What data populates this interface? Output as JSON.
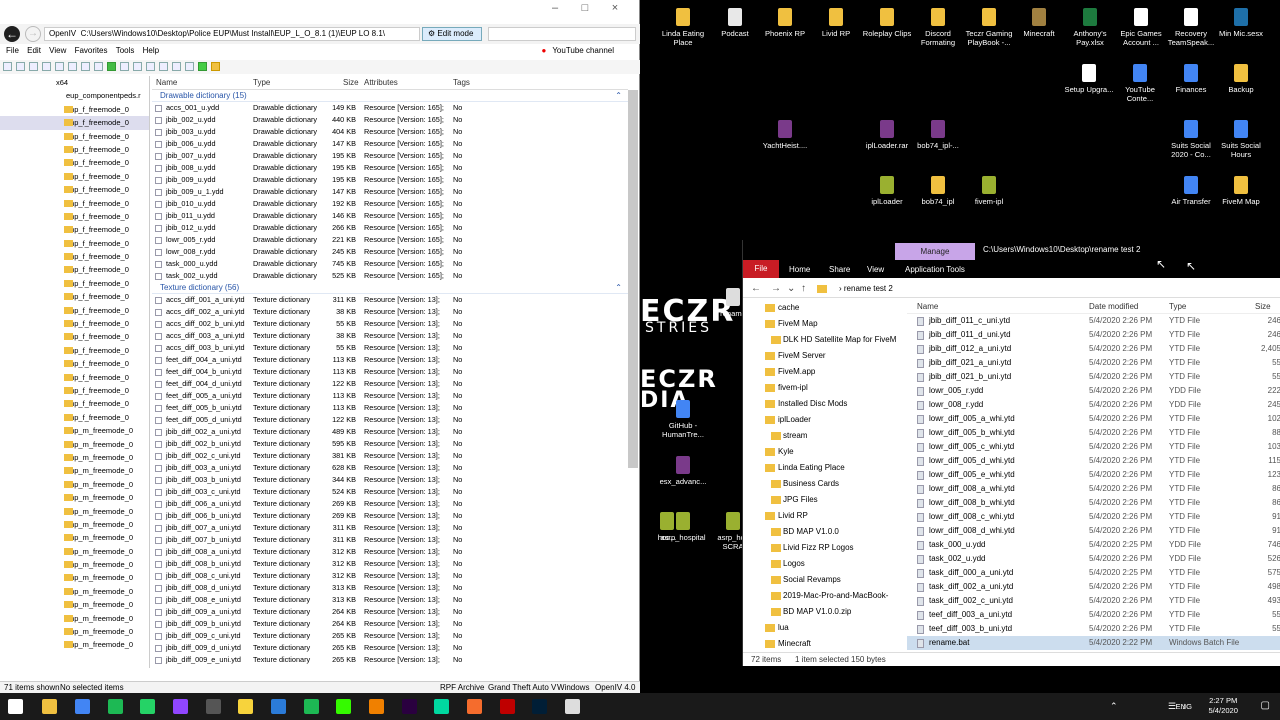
{
  "openiv": {
    "title": "OpenIV",
    "path": "C:\\Users\\Windows10\\Desktop\\Police EUP\\Must Install\\EUP_L_O_8.1 (1)\\EUP LO 8.1\\",
    "edit_mode": "Edit mode",
    "menu": [
      "File",
      "Edit",
      "View",
      "Favorites",
      "Tools",
      "Help"
    ],
    "youtube": "YouTube channel",
    "tree_header_1": "x64",
    "tree_header_2": "eup_componentpeds.r",
    "tree_items": [
      "mp_f_freemode_0",
      "mp_f_freemode_0",
      "mp_f_freemode_0",
      "mp_f_freemode_0",
      "mp_f_freemode_0",
      "mp_f_freemode_0",
      "mp_f_freemode_0",
      "mp_f_freemode_0",
      "mp_f_freemode_0",
      "mp_f_freemode_0",
      "mp_f_freemode_0",
      "mp_f_freemode_0",
      "mp_f_freemode_0",
      "mp_f_freemode_0",
      "mp_f_freemode_0",
      "mp_f_freemode_0",
      "mp_f_freemode_0",
      "mp_f_freemode_0",
      "mp_f_freemode_0",
      "mp_f_freemode_0",
      "mp_f_freemode_0",
      "mp_f_freemode_0",
      "mp_f_freemode_0",
      "mp_f_freemode_0",
      "mp_m_freemode_0",
      "mp_m_freemode_0",
      "mp_m_freemode_0",
      "mp_m_freemode_0",
      "mp_m_freemode_0",
      "mp_m_freemode_0",
      "mp_m_freemode_0",
      "mp_m_freemode_0",
      "mp_m_freemode_0",
      "mp_m_freemode_0",
      "mp_m_freemode_0",
      "mp_m_freemode_0",
      "mp_m_freemode_0",
      "mp_m_freemode_0",
      "mp_m_freemode_0",
      "mp_m_freemode_0",
      "mp_m_freemode_0"
    ],
    "columns": [
      "Name",
      "Type",
      "Size",
      "Attributes",
      "Tags"
    ],
    "group1": "Drawable dictionary (15)",
    "group2": "Texture dictionary (56)",
    "drawables": [
      [
        "accs_001_u.ydd",
        "Drawable dictionary",
        "149 KB",
        "Resource [Version: 165];",
        "No"
      ],
      [
        "jbib_002_u.ydd",
        "Drawable dictionary",
        "440 KB",
        "Resource [Version: 165];",
        "No"
      ],
      [
        "jbib_003_u.ydd",
        "Drawable dictionary",
        "404 KB",
        "Resource [Version: 165];",
        "No"
      ],
      [
        "jbib_006_u.ydd",
        "Drawable dictionary",
        "147 KB",
        "Resource [Version: 165];",
        "No"
      ],
      [
        "jbib_007_u.ydd",
        "Drawable dictionary",
        "195 KB",
        "Resource [Version: 165];",
        "No"
      ],
      [
        "jbib_008_u.ydd",
        "Drawable dictionary",
        "195 KB",
        "Resource [Version: 165];",
        "No"
      ],
      [
        "jbib_009_u.ydd",
        "Drawable dictionary",
        "195 KB",
        "Resource [Version: 165];",
        "No"
      ],
      [
        "jbib_009_u_1.ydd",
        "Drawable dictionary",
        "147 KB",
        "Resource [Version: 165];",
        "No"
      ],
      [
        "jbib_010_u.ydd",
        "Drawable dictionary",
        "192 KB",
        "Resource [Version: 165];",
        "No"
      ],
      [
        "jbib_011_u.ydd",
        "Drawable dictionary",
        "146 KB",
        "Resource [Version: 165];",
        "No"
      ],
      [
        "jbib_012_u.ydd",
        "Drawable dictionary",
        "266 KB",
        "Resource [Version: 165];",
        "No"
      ],
      [
        "lowr_005_r.ydd",
        "Drawable dictionary",
        "221 KB",
        "Resource [Version: 165];",
        "No"
      ],
      [
        "lowr_008_r.ydd",
        "Drawable dictionary",
        "245 KB",
        "Resource [Version: 165];",
        "No"
      ],
      [
        "task_000_u.ydd",
        "Drawable dictionary",
        "745 KB",
        "Resource [Version: 165];",
        "No"
      ],
      [
        "task_002_u.ydd",
        "Drawable dictionary",
        "525 KB",
        "Resource [Version: 165];",
        "No"
      ]
    ],
    "textures": [
      [
        "accs_diff_001_a_uni.ytd",
        "Texture dictionary",
        "311 KB",
        "Resource [Version: 13];",
        "No"
      ],
      [
        "accs_diff_002_a_uni.ytd",
        "Texture dictionary",
        "38 KB",
        "Resource [Version: 13];",
        "No"
      ],
      [
        "accs_diff_002_b_uni.ytd",
        "Texture dictionary",
        "55 KB",
        "Resource [Version: 13];",
        "No"
      ],
      [
        "accs_diff_003_a_uni.ytd",
        "Texture dictionary",
        "38 KB",
        "Resource [Version: 13];",
        "No"
      ],
      [
        "accs_diff_003_b_uni.ytd",
        "Texture dictionary",
        "55 KB",
        "Resource [Version: 13];",
        "No"
      ],
      [
        "feet_diff_004_a_uni.ytd",
        "Texture dictionary",
        "113 KB",
        "Resource [Version: 13];",
        "No"
      ],
      [
        "feet_diff_004_b_uni.ytd",
        "Texture dictionary",
        "113 KB",
        "Resource [Version: 13];",
        "No"
      ],
      [
        "feet_diff_004_d_uni.ytd",
        "Texture dictionary",
        "122 KB",
        "Resource [Version: 13];",
        "No"
      ],
      [
        "feet_diff_005_a_uni.ytd",
        "Texture dictionary",
        "113 KB",
        "Resource [Version: 13];",
        "No"
      ],
      [
        "feet_diff_005_b_uni.ytd",
        "Texture dictionary",
        "113 KB",
        "Resource [Version: 13];",
        "No"
      ],
      [
        "feet_diff_005_d_uni.ytd",
        "Texture dictionary",
        "122 KB",
        "Resource [Version: 13];",
        "No"
      ],
      [
        "jbib_diff_002_a_uni.ytd",
        "Texture dictionary",
        "489 KB",
        "Resource [Version: 13];",
        "No"
      ],
      [
        "jbib_diff_002_b_uni.ytd",
        "Texture dictionary",
        "595 KB",
        "Resource [Version: 13];",
        "No"
      ],
      [
        "jbib_diff_002_c_uni.ytd",
        "Texture dictionary",
        "381 KB",
        "Resource [Version: 13];",
        "No"
      ],
      [
        "jbib_diff_003_a_uni.ytd",
        "Texture dictionary",
        "628 KB",
        "Resource [Version: 13];",
        "No"
      ],
      [
        "jbib_diff_003_b_uni.ytd",
        "Texture dictionary",
        "344 KB",
        "Resource [Version: 13];",
        "No"
      ],
      [
        "jbib_diff_003_c_uni.ytd",
        "Texture dictionary",
        "524 KB",
        "Resource [Version: 13];",
        "No"
      ],
      [
        "jbib_diff_006_a_uni.ytd",
        "Texture dictionary",
        "269 KB",
        "Resource [Version: 13];",
        "No"
      ],
      [
        "jbib_diff_006_b_uni.ytd",
        "Texture dictionary",
        "269 KB",
        "Resource [Version: 13];",
        "No"
      ],
      [
        "jbib_diff_007_a_uni.ytd",
        "Texture dictionary",
        "311 KB",
        "Resource [Version: 13];",
        "No"
      ],
      [
        "jbib_diff_007_b_uni.ytd",
        "Texture dictionary",
        "311 KB",
        "Resource [Version: 13];",
        "No"
      ],
      [
        "jbib_diff_008_a_uni.ytd",
        "Texture dictionary",
        "312 KB",
        "Resource [Version: 13];",
        "No"
      ],
      [
        "jbib_diff_008_b_uni.ytd",
        "Texture dictionary",
        "312 KB",
        "Resource [Version: 13];",
        "No"
      ],
      [
        "jbib_diff_008_c_uni.ytd",
        "Texture dictionary",
        "312 KB",
        "Resource [Version: 13];",
        "No"
      ],
      [
        "jbib_diff_008_d_uni.ytd",
        "Texture dictionary",
        "313 KB",
        "Resource [Version: 13];",
        "No"
      ],
      [
        "jbib_diff_008_e_uni.ytd",
        "Texture dictionary",
        "313 KB",
        "Resource [Version: 13];",
        "No"
      ],
      [
        "jbib_diff_009_a_uni.ytd",
        "Texture dictionary",
        "264 KB",
        "Resource [Version: 13];",
        "No"
      ],
      [
        "jbib_diff_009_b_uni.ytd",
        "Texture dictionary",
        "264 KB",
        "Resource [Version: 13];",
        "No"
      ],
      [
        "jbib_diff_009_c_uni.ytd",
        "Texture dictionary",
        "265 KB",
        "Resource [Version: 13];",
        "No"
      ],
      [
        "jbib_diff_009_d_uni.ytd",
        "Texture dictionary",
        "265 KB",
        "Resource [Version: 13];",
        "No"
      ],
      [
        "jbib_diff_009_e_uni.ytd",
        "Texture dictionary",
        "265 KB",
        "Resource [Version: 13];",
        "No"
      ]
    ],
    "status": {
      "shown": "71 items shown",
      "selected": "No selected items",
      "archive": "RPF Archive",
      "game": "Grand Theft Auto V",
      "os": "Windows",
      "version": "OpenIV 4.0"
    }
  },
  "desktop": {
    "icons": [
      {
        "label": "Linda Eating Place",
        "color": "#f0c040"
      },
      {
        "label": "Podcast",
        "color": "#e8e8e8"
      },
      {
        "label": "Phoenix RP",
        "color": "#f0c040"
      },
      {
        "label": "Livid RP",
        "color": "#f0c040"
      },
      {
        "label": "Roleplay Clips",
        "color": "#f0c040"
      },
      {
        "label": "Discord Formating",
        "color": "#f0c040"
      },
      {
        "label": "Teczr Gaming PlayBook -...",
        "color": "#f0c040"
      },
      {
        "label": "Minecraft",
        "color": "#a08040"
      },
      {
        "label": "Anthony's Pay.xlsx",
        "color": "#1d7a3e"
      },
      {
        "label": "Epic Games Account ...",
        "color": "#ffffff"
      },
      {
        "label": "Recovery TeamSpeak...",
        "color": "#ffffff"
      },
      {
        "label": "Min Mic.sesx",
        "color": "#1e6fa8"
      },
      {
        "label": "Setup Upgra...",
        "color": "#ffffff"
      },
      {
        "label": "YouTube Conte...",
        "color": "#4285f4"
      },
      {
        "label": "Finances",
        "color": "#4285f4"
      },
      {
        "label": "Backup",
        "color": "#f0c040"
      },
      {
        "label": "YachtHeist....",
        "color": "#7a3a8a"
      },
      {
        "label": "iplLoader.rar",
        "color": "#7a3a8a"
      },
      {
        "label": "bob74_ipl-...",
        "color": "#7a3a8a"
      },
      {
        "label": "Suits Social 2020 - Co...",
        "color": "#4285f4"
      },
      {
        "label": "Suits Social Hours",
        "color": "#4285f4"
      },
      {
        "label": "iplLoader",
        "color": "#9ab030"
      },
      {
        "label": "bob74_ipl",
        "color": "#f0c040"
      },
      {
        "label": "fivem-ipl",
        "color": "#9ab030"
      },
      {
        "label": "Air Transfer",
        "color": "#4285f4"
      },
      {
        "label": "FiveM Map",
        "color": "#f0c040"
      },
      {
        "label": "GitHub - HumanTre...",
        "color": "#4285f4"
      },
      {
        "label": "esx_advanc...",
        "color": "#7a3a8a"
      },
      {
        "label": "asrp_hospital",
        "color": "#9ab030"
      },
      {
        "label": "asrp_hos SCRA",
        "color": "#9ab030"
      },
      {
        "label": "rename",
        "color": "#dddddd"
      },
      {
        "label": "hos...",
        "color": "#9ab030"
      }
    ],
    "wallpaper_text_1": "ECZR",
    "wallpaper_text_2": "STRIES",
    "wallpaper_text_3": "ECZR",
    "wallpaper_text_4": "DIA"
  },
  "explorer": {
    "manage": "Manage",
    "title_path": "C:\\Users\\Windows10\\Desktop\\rename test 2",
    "ribbon": [
      "File",
      "Home",
      "Share",
      "View",
      "Application Tools"
    ],
    "crumb": "rename test 2",
    "tree": [
      {
        "label": "cache",
        "sub": false
      },
      {
        "label": "FiveM Map",
        "sub": false
      },
      {
        "label": "DLK HD Satellite Map for FiveM",
        "sub": true
      },
      {
        "label": "FiveM Server",
        "sub": false
      },
      {
        "label": "FiveM.app",
        "sub": false
      },
      {
        "label": "fivem-ipl",
        "sub": false
      },
      {
        "label": "Installed Disc Mods",
        "sub": false
      },
      {
        "label": "iplLoader",
        "sub": false
      },
      {
        "label": "stream",
        "sub": true
      },
      {
        "label": "Kyle",
        "sub": false
      },
      {
        "label": "Linda Eating Place",
        "sub": false
      },
      {
        "label": "Business Cards",
        "sub": true
      },
      {
        "label": "JPG Files",
        "sub": true
      },
      {
        "label": "Livid RP",
        "sub": false
      },
      {
        "label": "BD MAP V1.0.0",
        "sub": true
      },
      {
        "label": "Livid Fizz RP Logos",
        "sub": true
      },
      {
        "label": "Logos",
        "sub": true
      },
      {
        "label": "Social Revamps",
        "sub": true
      },
      {
        "label": "2019-Mac-Pro-and-MacBook-",
        "sub": true
      },
      {
        "label": "BD MAP V1.0.0.zip",
        "sub": true
      },
      {
        "label": "lua",
        "sub": false
      },
      {
        "label": "Minecraft",
        "sub": false
      }
    ],
    "columns": [
      "Name",
      "Date modified",
      "Type",
      "Size"
    ],
    "files": [
      [
        "jbib_diff_011_c_uni.ytd",
        "5/4/2020 2:26 PM",
        "YTD File",
        "246"
      ],
      [
        "jbib_diff_011_d_uni.ytd",
        "5/4/2020 2:26 PM",
        "YTD File",
        "246"
      ],
      [
        "jbib_diff_012_a_uni.ytd",
        "5/4/2020 2:26 PM",
        "YTD File",
        "2,405"
      ],
      [
        "jbib_diff_021_a_uni.ytd",
        "5/4/2020 2:26 PM",
        "YTD File",
        "55"
      ],
      [
        "jbib_diff_021_b_uni.ytd",
        "5/4/2020 2:26 PM",
        "YTD File",
        "55"
      ],
      [
        "lowr_005_r.ydd",
        "5/4/2020 2:26 PM",
        "YDD File",
        "222"
      ],
      [
        "lowr_008_r.ydd",
        "5/4/2020 2:26 PM",
        "YDD File",
        "245"
      ],
      [
        "lowr_diff_005_a_whi.ytd",
        "5/4/2020 2:26 PM",
        "YTD File",
        "102"
      ],
      [
        "lowr_diff_005_b_whi.ytd",
        "5/4/2020 2:26 PM",
        "YTD File",
        "88"
      ],
      [
        "lowr_diff_005_c_whi.ytd",
        "5/4/2020 2:26 PM",
        "YTD File",
        "103"
      ],
      [
        "lowr_diff_005_d_whi.ytd",
        "5/4/2020 2:26 PM",
        "YTD File",
        "115"
      ],
      [
        "lowr_diff_005_e_whi.ytd",
        "5/4/2020 2:26 PM",
        "YTD File",
        "123"
      ],
      [
        "lowr_diff_008_a_whi.ytd",
        "5/4/2020 2:26 PM",
        "YTD File",
        "86"
      ],
      [
        "lowr_diff_008_b_whi.ytd",
        "5/4/2020 2:26 PM",
        "YTD File",
        "86"
      ],
      [
        "lowr_diff_008_c_whi.ytd",
        "5/4/2020 2:26 PM",
        "YTD File",
        "91"
      ],
      [
        "lowr_diff_008_d_whi.ytd",
        "5/4/2020 2:26 PM",
        "YTD File",
        "91"
      ],
      [
        "task_000_u.ydd",
        "5/4/2020 2:25 PM",
        "YDD File",
        "746"
      ],
      [
        "task_002_u.ydd",
        "5/4/2020 2:26 PM",
        "YDD File",
        "526"
      ],
      [
        "task_diff_000_a_uni.ytd",
        "5/4/2020 2:25 PM",
        "YTD File",
        "575"
      ],
      [
        "task_diff_002_a_uni.ytd",
        "5/4/2020 2:26 PM",
        "YTD File",
        "498"
      ],
      [
        "task_diff_002_c_uni.ytd",
        "5/4/2020 2:26 PM",
        "YTD File",
        "493"
      ],
      [
        "teef_diff_003_a_uni.ytd",
        "5/4/2020 2:26 PM",
        "YTD File",
        "55"
      ],
      [
        "teef_diff_003_b_uni.ytd",
        "5/4/2020 2:26 PM",
        "YTD File",
        "55"
      ],
      [
        "rename.bat",
        "5/4/2020 2:22 PM",
        "Windows Batch File",
        ""
      ]
    ],
    "status": {
      "count": "72 items",
      "selected": "1 item selected  150 bytes"
    }
  },
  "taskbar": {
    "apps": [
      {
        "name": "start-icon",
        "color": "#ffffff"
      },
      {
        "name": "file-explorer-icon",
        "color": "#f0c040"
      },
      {
        "name": "chrome-icon",
        "color": "#4285f4"
      },
      {
        "name": "spotify-icon",
        "color": "#1db954"
      },
      {
        "name": "whatsapp-icon",
        "color": "#25d366"
      },
      {
        "name": "twitch-icon",
        "color": "#9146ff"
      },
      {
        "name": "obs-icon",
        "color": "#555555"
      },
      {
        "name": "sticky-notes-icon",
        "color": "#f7d33c"
      },
      {
        "name": "paint-icon",
        "color": "#2b7bd8"
      },
      {
        "name": "spotify-alt-icon",
        "color": "#1db954"
      },
      {
        "name": "dreamweaver-icon",
        "color": "#35fa00"
      },
      {
        "name": "vlc-icon",
        "color": "#f08000"
      },
      {
        "name": "premiere-icon",
        "color": "#2a003f"
      },
      {
        "name": "audition-icon",
        "color": "#00d8a0"
      },
      {
        "name": "origin-icon",
        "color": "#f56c2d"
      },
      {
        "name": "filezilla-icon",
        "color": "#bf0000"
      },
      {
        "name": "photoshop-icon",
        "color": "#001e36"
      },
      {
        "name": "openiv-icon",
        "color": "#dddddd"
      }
    ],
    "lang": "ENG",
    "time": "2:27 PM",
    "date": "5/4/2020"
  }
}
